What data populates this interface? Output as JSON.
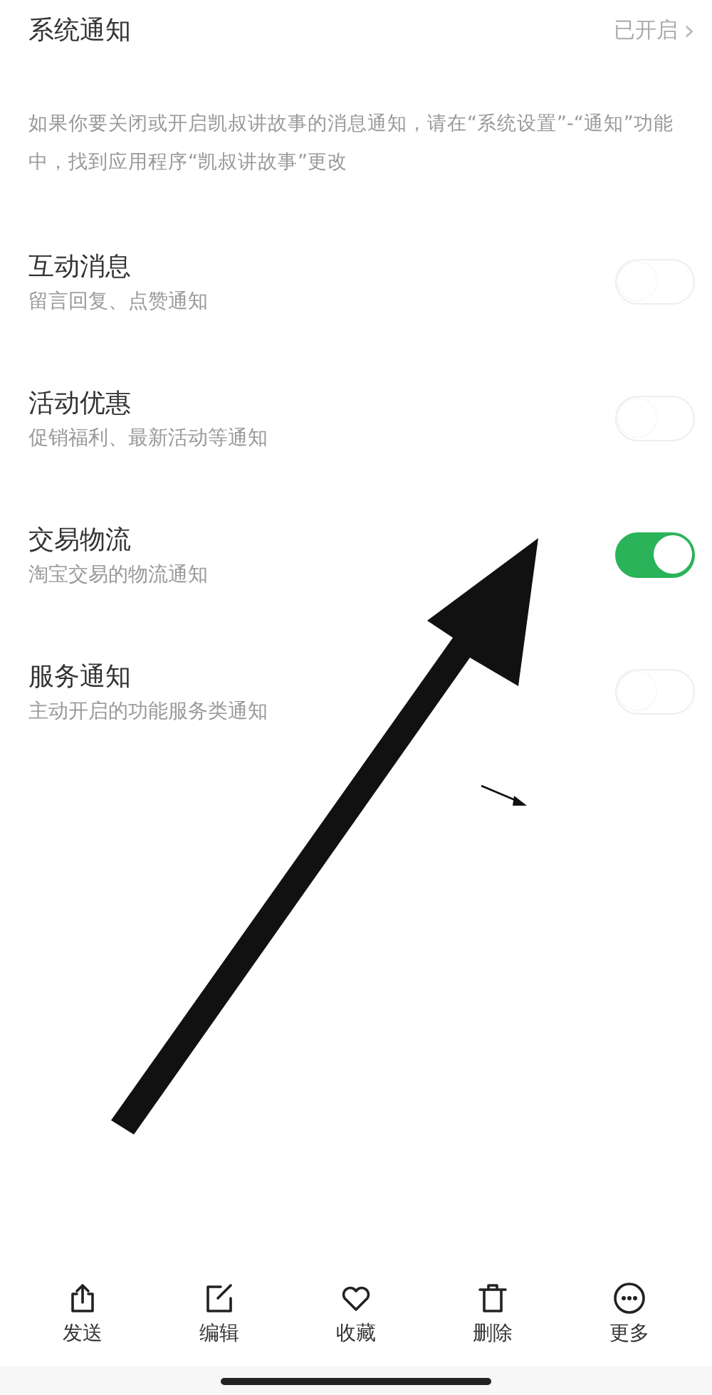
{
  "header": {
    "title": "系统通知",
    "status": "已开启",
    "chevron": "›"
  },
  "description": "如果你要关闭或开启凯叔讲故事的消息通知，请在“系统设置”-“通知”功能中，找到应用程序“凯叔讲故事”更改",
  "settings": [
    {
      "title": "互动消息",
      "subtitle": "留言回复、点赞通知",
      "on": false
    },
    {
      "title": "活动优惠",
      "subtitle": "促销福利、最新活动等通知",
      "on": false
    },
    {
      "title": "交易物流",
      "subtitle": "淘宝交易的物流通知",
      "on": true
    },
    {
      "title": "服务通知",
      "subtitle": "主动开启的功能服务类通知",
      "on": false
    }
  ],
  "toolbar": [
    {
      "kind": "share",
      "label": "发送"
    },
    {
      "kind": "edit",
      "label": "编辑"
    },
    {
      "kind": "favorite",
      "label": "收藏"
    },
    {
      "kind": "delete",
      "label": "删除"
    },
    {
      "kind": "more",
      "label": "更多"
    }
  ]
}
